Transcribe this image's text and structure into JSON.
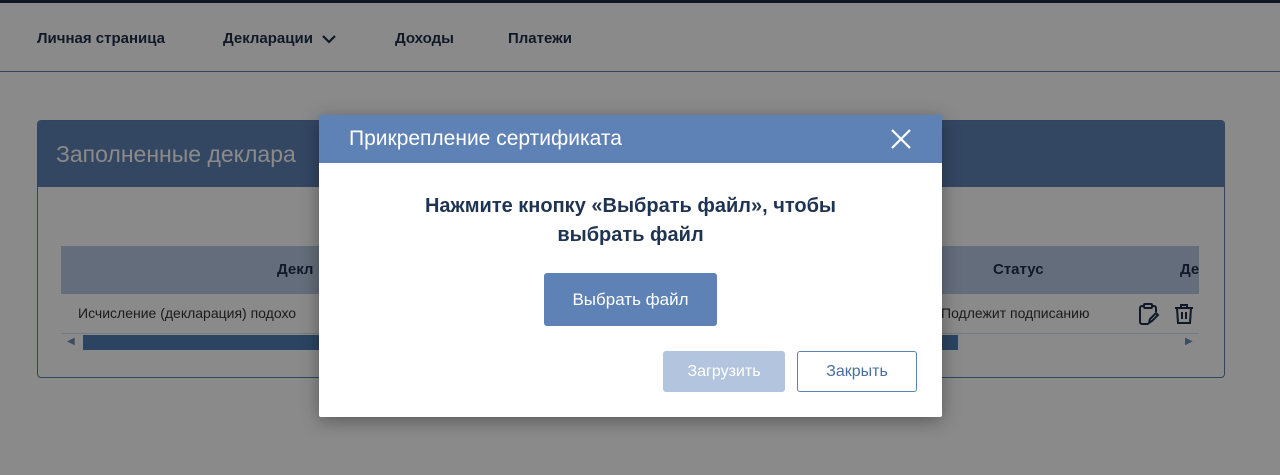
{
  "nav": {
    "items": [
      {
        "label": "Личная страница"
      },
      {
        "label": "Декларации"
      },
      {
        "label": "Доходы"
      },
      {
        "label": "Платежи"
      }
    ]
  },
  "panel": {
    "title": "Заполненные деклара",
    "table": {
      "headers": [
        "Декл",
        "Статус",
        "Де"
      ],
      "rows": [
        {
          "name": "Исчисление (декларация) подохо",
          "status": "Подлежит подписанию"
        }
      ]
    }
  },
  "modal": {
    "title": "Прикрепление сертификата",
    "message_line1": "Нажмите кнопку «Выбрать файл», чтобы",
    "message_line2": "выбрать файл",
    "choose_file_label": "Выбрать файл",
    "upload_label": "Загрузить",
    "close_label": "Закрыть"
  },
  "colors": {
    "accent": "#5f82b6",
    "upload_disabled": "#b3c4de",
    "nav_text": "#1f2f4a"
  },
  "icons": [
    "chevron-down-icon",
    "close-icon",
    "clipboard-edit-icon",
    "trash-icon"
  ]
}
